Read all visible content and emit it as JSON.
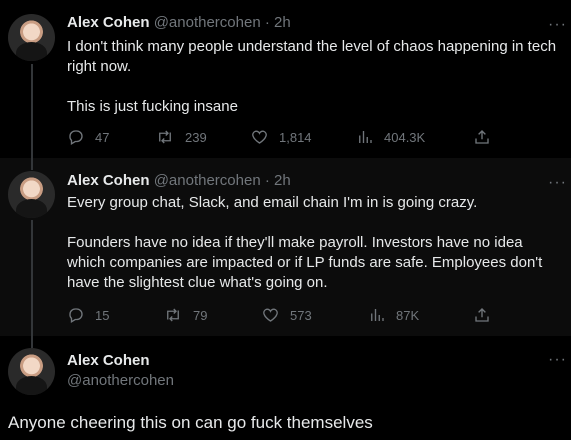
{
  "tweets": [
    {
      "name": "Alex Cohen",
      "handle": "@anothercohen",
      "separator": "·",
      "time": "2h",
      "more": "···",
      "paragraphs": [
        "I don't think many people understand the level of chaos happening in tech right now.",
        "This is just fucking insane"
      ],
      "replies": "47",
      "retweets": "239",
      "likes": "1,814",
      "views": "404.3K"
    },
    {
      "name": "Alex Cohen",
      "handle": "@anothercohen",
      "separator": "·",
      "time": "2h",
      "more": "···",
      "paragraphs": [
        "Every group chat, Slack, and email chain I'm in is going crazy.",
        "Founders have no idea if they'll make payroll. Investors have no idea which companies are impacted or if LP funds are safe. Employees don't have the slightest clue what's going on."
      ],
      "replies": "15",
      "retweets": "79",
      "likes": "573",
      "views": "87K"
    },
    {
      "name": "Alex Cohen",
      "handle": "@anothercohen",
      "more": "···",
      "text": "Anyone cheering this on can go fuck themselves"
    }
  ],
  "icons": {
    "reply": "reply-icon",
    "retweet": "retweet-icon",
    "like": "heart-icon",
    "views": "analytics-icon",
    "share": "share-icon"
  },
  "colors": {
    "background": "#000000",
    "text": "#e7e9ea",
    "muted": "#71767b",
    "thread_line": "#333639"
  }
}
